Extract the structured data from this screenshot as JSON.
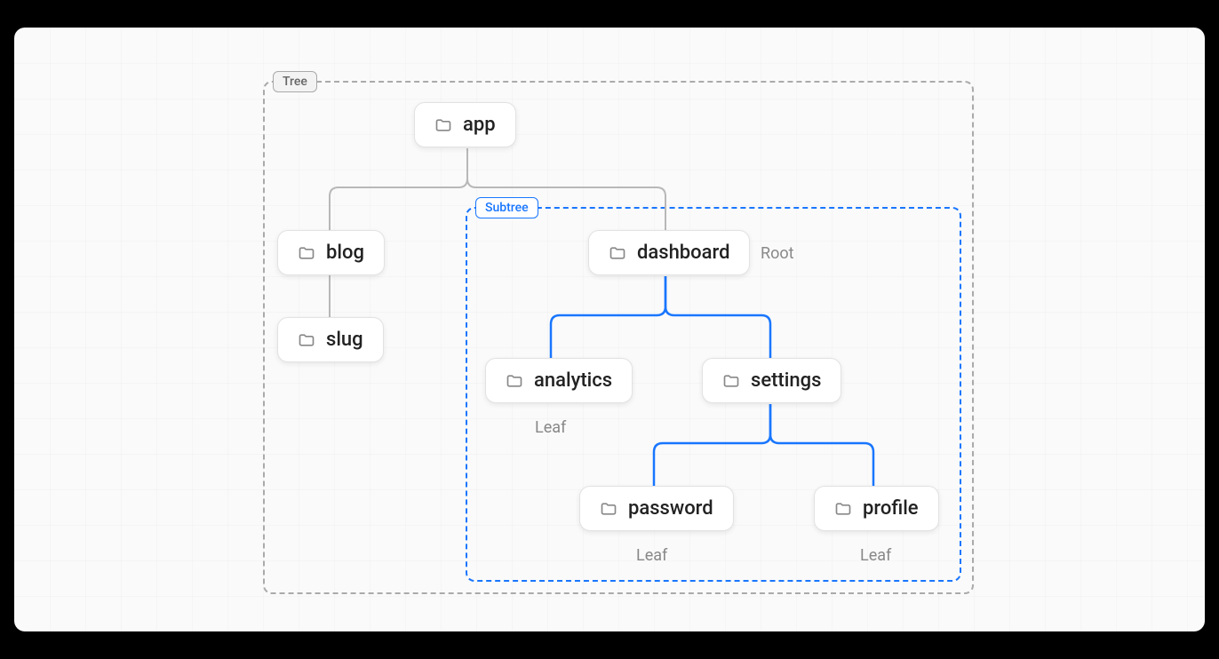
{
  "labels": {
    "tree": "Tree",
    "subtree": "Subtree",
    "root": "Root",
    "leaf": "Leaf"
  },
  "nodes": {
    "app": {
      "name": "app"
    },
    "blog": {
      "name": "blog"
    },
    "slug": {
      "name": "slug"
    },
    "dashboard": {
      "name": "dashboard"
    },
    "analytics": {
      "name": "analytics"
    },
    "settings": {
      "name": "settings"
    },
    "password": {
      "name": "password"
    },
    "profile": {
      "name": "profile"
    }
  },
  "colors": {
    "subtree": "#1976ff",
    "tree": "#aaaaaa",
    "connector_gray": "#b8b8b8",
    "connector_blue": "#1976ff"
  },
  "tree_structure": {
    "root": "app",
    "children": {
      "app": [
        "blog",
        "dashboard"
      ],
      "blog": [
        "slug"
      ],
      "dashboard": [
        "analytics",
        "settings"
      ],
      "settings": [
        "password",
        "profile"
      ]
    },
    "subtree_root": "dashboard",
    "leaves": [
      "slug",
      "analytics",
      "password",
      "profile"
    ]
  }
}
